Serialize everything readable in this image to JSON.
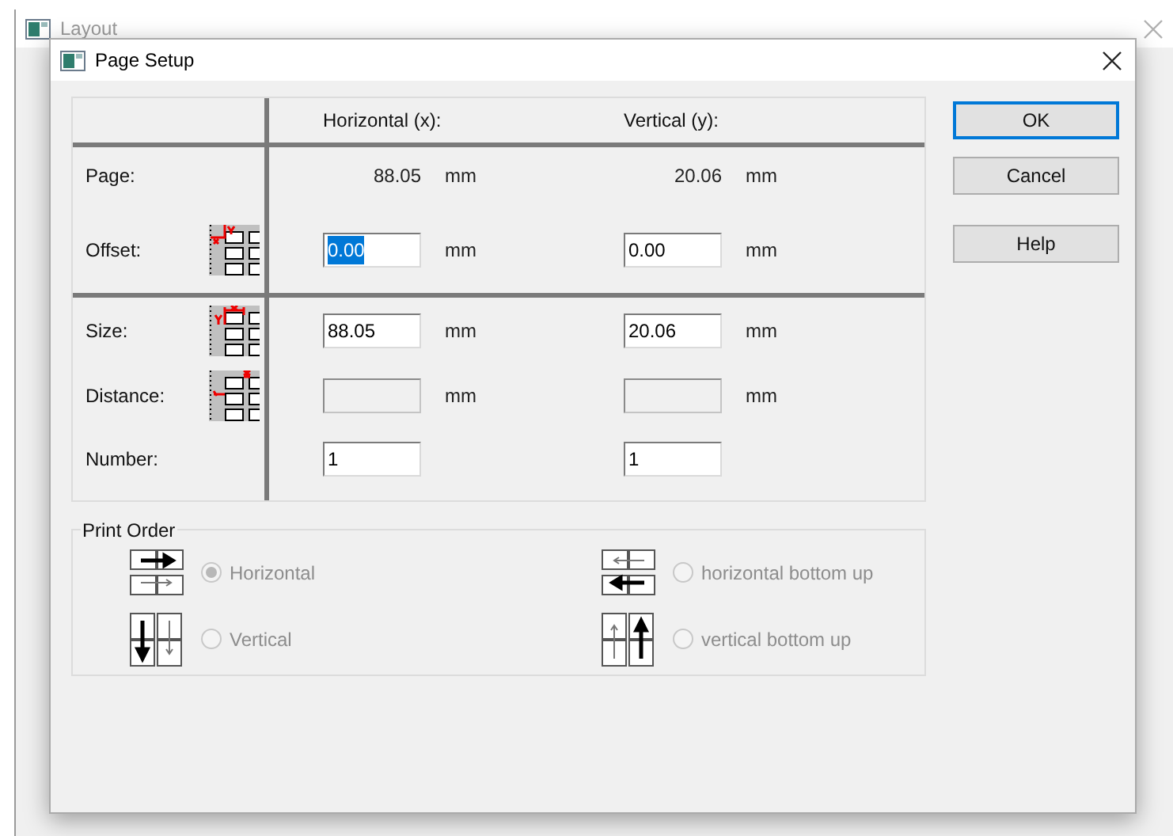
{
  "background_window": {
    "title": "Layout"
  },
  "dialog": {
    "title": "Page Setup"
  },
  "columns": [
    "Horizontal (x):",
    "Vertical (y):"
  ],
  "rows": [
    {
      "kind": "page",
      "label": "Page:",
      "x": {
        "value": "88.05"
      },
      "y": {
        "value": "20.06"
      },
      "x_unit": "mm",
      "y_unit": "mm"
    },
    {
      "kind": "offset",
      "label": "Offset:",
      "x": {
        "value": "0.00",
        "disabled": false,
        "text_highlighted": true
      },
      "y": {
        "value": "0.00",
        "disabled": false,
        "text_highlighted": false
      },
      "x_unit": "mm",
      "y_unit": "mm"
    },
    {
      "kind": "size",
      "label": "Size:",
      "x": {
        "value": "88.05",
        "disabled": false,
        "text_highlighted": false
      },
      "y": {
        "value": "20.06",
        "disabled": false,
        "text_highlighted": false
      },
      "x_unit": "mm",
      "y_unit": "mm"
    },
    {
      "kind": "distance",
      "label": "Distance:",
      "x": {
        "disabled": true
      },
      "y": {
        "disabled": true
      },
      "x_unit": "mm",
      "y_unit": "mm"
    },
    {
      "kind": "number",
      "label": "Number:",
      "x": {
        "value": "1",
        "disabled": false,
        "text_highlighted": false
      },
      "y": {
        "value": "1",
        "disabled": false,
        "text_highlighted": false
      }
    }
  ],
  "buttons": [
    {
      "label": "OK",
      "default": true
    },
    {
      "label": "Cancel",
      "default": false
    },
    {
      "label": "Help",
      "default": false
    }
  ],
  "print_order": {
    "title": "Print Order",
    "options": [
      {
        "kind": "horizontal",
        "label": "Horizontal",
        "selected": true,
        "disabled": true
      },
      {
        "kind": "horizontal_bottom_up",
        "label": "horizontal bottom up",
        "selected": false,
        "disabled": true
      },
      {
        "kind": "vertical",
        "label": "Vertical",
        "selected": false,
        "disabled": true
      },
      {
        "kind": "vertical_bottom_up",
        "label": "vertical bottom up",
        "selected": false,
        "disabled": true
      }
    ]
  }
}
